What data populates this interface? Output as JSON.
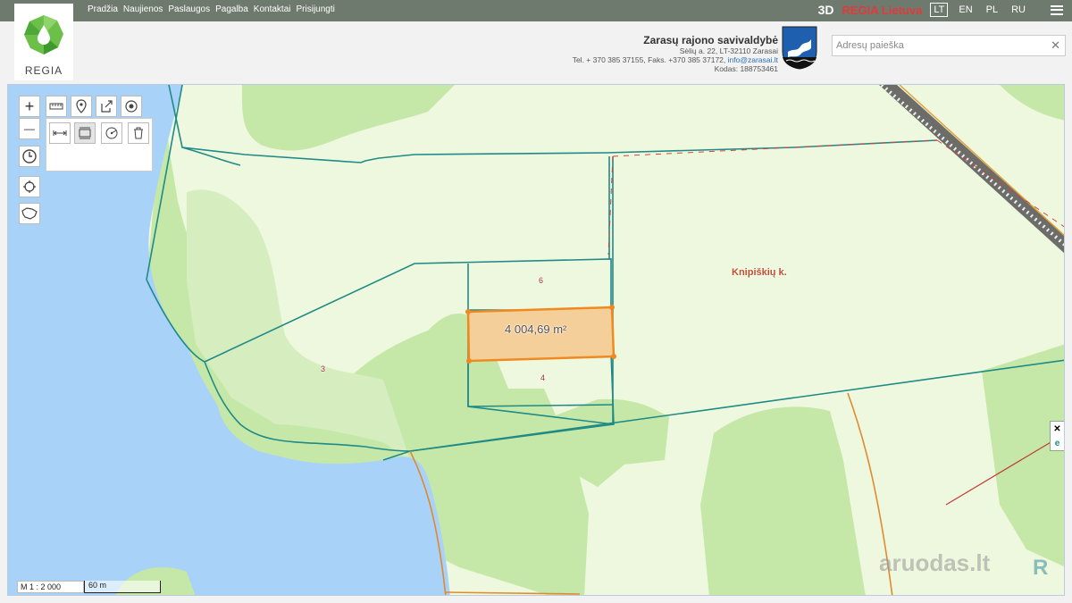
{
  "nav": {
    "items": [
      "Pradžia",
      "Naujienos",
      "Paslaugos",
      "Pagalba",
      "Kontaktai",
      "Prisijungti"
    ],
    "mode_3d": "3D",
    "brand": "REGIA Lietuva",
    "languages": [
      "LT",
      "EN",
      "PL",
      "RU"
    ],
    "active_language": "LT"
  },
  "logo": {
    "text": "REGIA"
  },
  "municipality": {
    "name": "Zarasų rajono savivaldybė",
    "address": "Sėlių a. 22, LT-32110 Zarasai",
    "phones": "Tel. + 370 385 37155, Faks. +370 385 37172,",
    "email": "info@zarasai.lt",
    "code": "Kodas: 188753461"
  },
  "search": {
    "placeholder": "Adresų paieška",
    "clear_glyph": "✕"
  },
  "map": {
    "selected_area": "4 004,69 m²",
    "parcel_labels": [
      "6",
      "4",
      "3"
    ],
    "place_name": "Knipiškių k.",
    "scale_ratio": "M 1 : 2 000",
    "scale_length": "60 m",
    "watermark": "aruodas.lt",
    "watermark_logo": "R",
    "colors": {
      "water": "#a8d2f8",
      "forest": "#c5e8a8",
      "open_land": "#eef8de",
      "parcel_line": "#1f8a86",
      "selection_fill": "#f5cf9a",
      "selection_stroke": "#f08a20"
    }
  },
  "tools": {
    "zoom_in": "+",
    "zoom_out": "—",
    "side_close": "✕",
    "side_e": "e"
  }
}
